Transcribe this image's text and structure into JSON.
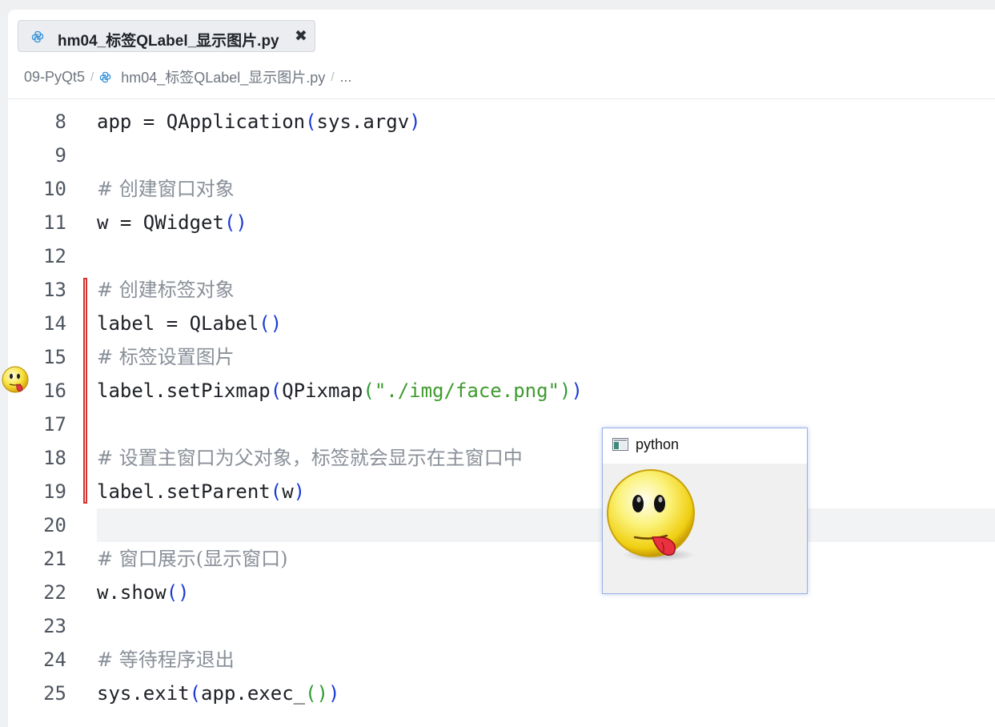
{
  "tab": {
    "label": "hm04_标签QLabel_显示图片.py",
    "close": "✖"
  },
  "breadcrumb": {
    "folder": "09-PyQt5",
    "sep1": "/",
    "file": "hm04_标签QLabel_显示图片.py",
    "sep2": "/",
    "more": "..."
  },
  "code": {
    "lines": [
      {
        "n": "8"
      },
      {
        "n": "9"
      },
      {
        "n": "10"
      },
      {
        "n": "11"
      },
      {
        "n": "12"
      },
      {
        "n": "13"
      },
      {
        "n": "14"
      },
      {
        "n": "15"
      },
      {
        "n": "16"
      },
      {
        "n": "17"
      },
      {
        "n": "18"
      },
      {
        "n": "19"
      },
      {
        "n": "20"
      },
      {
        "n": "21"
      },
      {
        "n": "22"
      },
      {
        "n": "23"
      },
      {
        "n": "24"
      },
      {
        "n": "25"
      }
    ],
    "t8a": "app = QApplication",
    "t8b": "(",
    "t8c": "sys.argv",
    "t8d": ")",
    "t10": "# 创建窗口对象",
    "t11a": "w = QWidget",
    "t11b": "()",
    "t13": "# 创建标签对象",
    "t14a": "label = QLabel",
    "t14b": "()",
    "t15": "# 标签设置图片",
    "t16a": "label.setPixmap",
    "t16b": "(",
    "t16c": "QPixmap",
    "t16d": "(",
    "t16e": "\"./img/face.png\"",
    "t16f": ")",
    "t16g": ")",
    "t18": "# 设置主窗口为父对象，标签就会显示在主窗口中",
    "t19a": "label.setParent",
    "t19b": "(",
    "t19c": "w",
    "t19d": ")",
    "t21": "# 窗口展示(显示窗口)",
    "t22a": "w.show",
    "t22b": "()",
    "t24": "# 等待程序退出",
    "t25a": "sys.exit",
    "t25b": "(",
    "t25c": "app.exec_",
    "t25d": "()",
    "t25e": ")"
  },
  "popup": {
    "title": "python"
  },
  "icons": {
    "tab": "python-file-icon",
    "breadcrumb": "python-file-icon",
    "gutter": "tongue-face-icon",
    "popup_window": "window-icon",
    "popup_content": "tongue-face-image"
  },
  "colors": {
    "paren_level1": "#1a3ad3",
    "paren_level2": "#2e9a33",
    "string": "#3f9b2f",
    "comment": "#8a9099",
    "change_marker": "#d63131"
  }
}
